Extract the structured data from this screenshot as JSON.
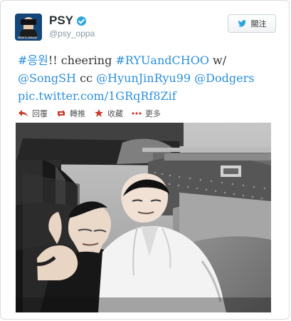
{
  "tweet": {
    "display_name": "PSY",
    "handle": "@psy_oppa",
    "follow_label": "關注",
    "text": {
      "line1": {
        "hashtag_korean": "#응원",
        "rest_before_tag": "!! cheering ",
        "hashtag_ryu_choo": "#RYUandCHOO",
        "after_tag": " w/"
      },
      "line2": {
        "mention_song": "@SongSH",
        "cc": " cc ",
        "mention_ryu": "@HyunJinRyu99",
        "space": " ",
        "mention_dodgers": "@Dodgers"
      },
      "line3": {
        "photo_link": "pic.twitter.com/1GRqRf8Zif"
      }
    },
    "actions": {
      "reply": "回覆",
      "retweet": "轉推",
      "favorite": "收藏",
      "more": "更多"
    },
    "avatar_text": "GENTLEMAN"
  },
  "icons": {
    "verified": "verified-icon",
    "bird": "twitter-bird-icon",
    "reply": "reply-icon",
    "retweet": "retweet-icon",
    "favorite": "favorite-icon",
    "more": "more-icon"
  },
  "colors": {
    "link_blue": "#2b8fdc",
    "verified_blue": "#2da6de",
    "text": "#333333",
    "muted": "#8899a6"
  }
}
